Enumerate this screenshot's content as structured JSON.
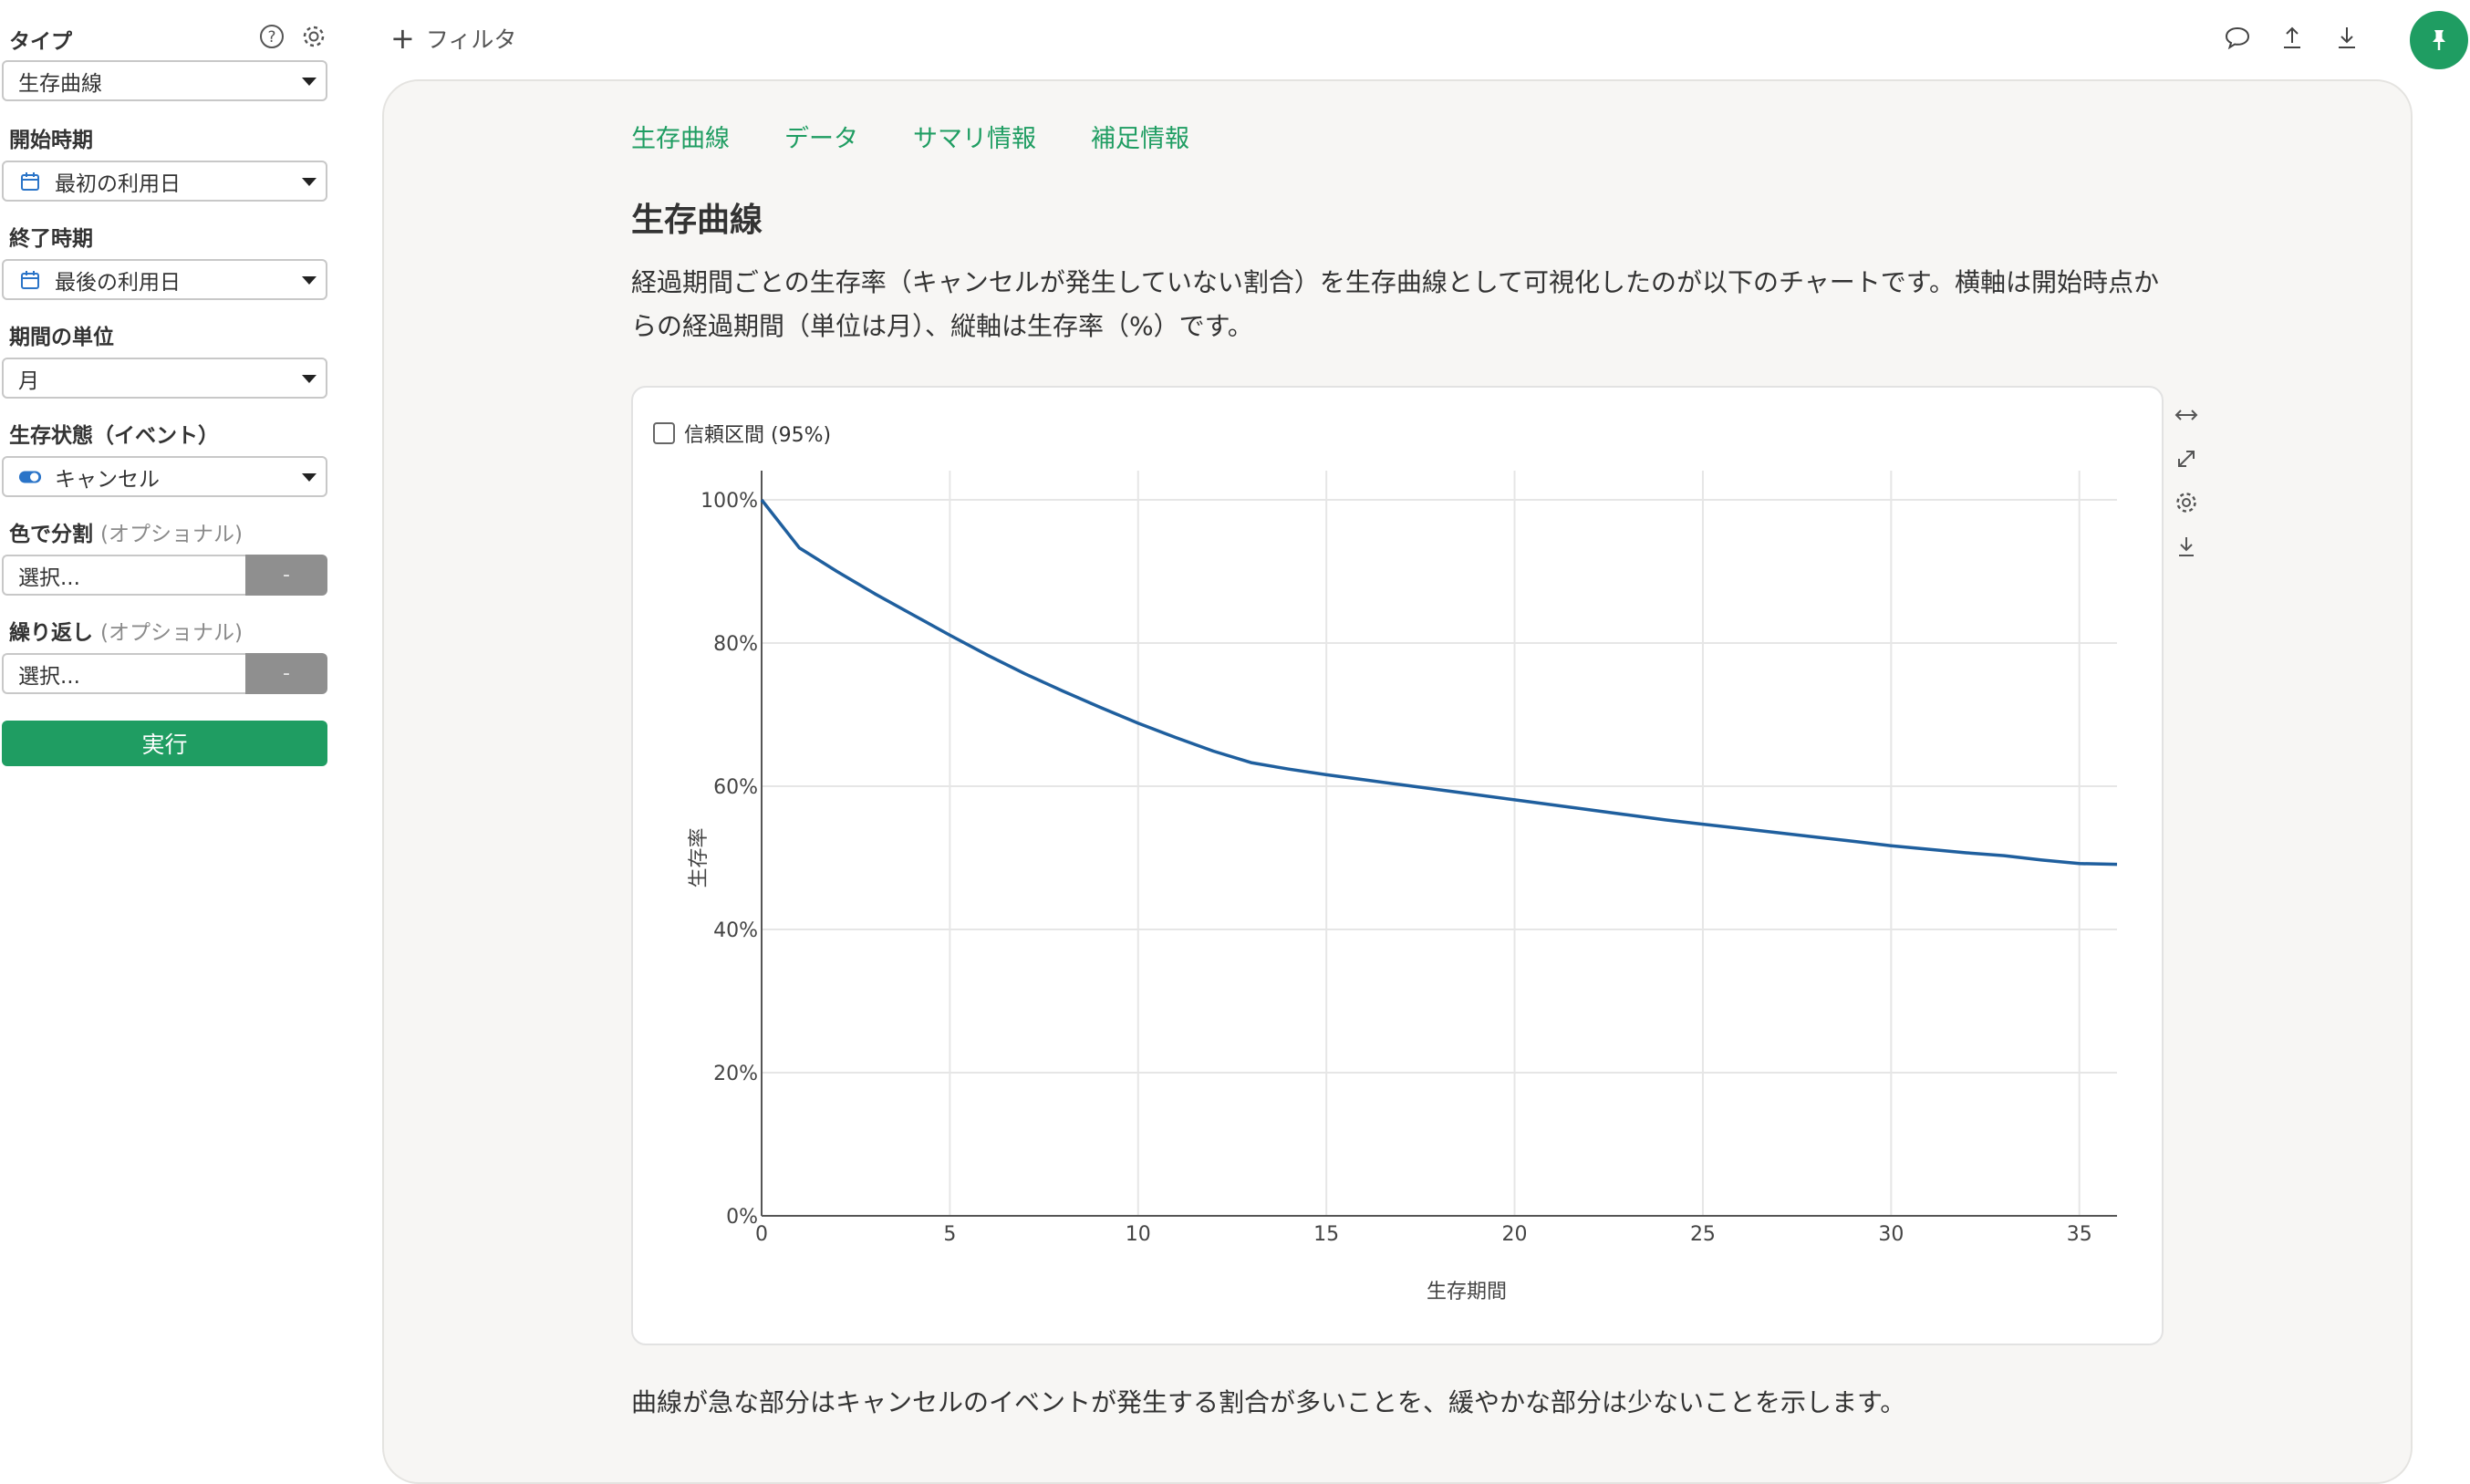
{
  "sidebar": {
    "type": {
      "label": "タイプ",
      "value": "生存曲線"
    },
    "start": {
      "label": "開始時期",
      "value": "最初の利用日"
    },
    "end": {
      "label": "終了時期",
      "value": "最後の利用日"
    },
    "unit": {
      "label": "期間の単位",
      "value": "月"
    },
    "event": {
      "label": "生存状態（イベント）",
      "value": "キャンセル"
    },
    "color_split": {
      "label": "色で分割",
      "optional": "(オプショナル)",
      "placeholder": "選択...",
      "button": "-"
    },
    "repeat": {
      "label": "繰り返し",
      "optional": "(オプショナル)",
      "placeholder": "選択...",
      "button": "-"
    },
    "run_button": "実行"
  },
  "topbar": {
    "filter_label": "フィルタ",
    "icons": [
      "comment-icon",
      "upload-icon",
      "download-icon",
      "pin-icon"
    ]
  },
  "tabs": [
    "生存曲線",
    "データ",
    "サマリ情報",
    "補足情報"
  ],
  "section_title": "生存曲線",
  "description": "経過期間ごとの生存率（キャンセルが発生していない割合）を生存曲線として可視化したのが以下のチャートです。横軸は開始時点からの経過期間（単位は月）、縦軸は生存率（%）です。",
  "chart": {
    "ci_label": "信頼区間 (95%)",
    "tool_icons": [
      "expand-horizontal-icon",
      "fullscreen-icon",
      "gear-icon",
      "download-icon"
    ]
  },
  "footer": "曲線が急な部分はキャンセルのイベントが発生する割合が多いことを、緩やかな部分は少ないことを示します。",
  "colors": {
    "accent": "#1f9d62",
    "line": "#1f5f9e",
    "grid": "#e6e6e6"
  },
  "chart_data": {
    "type": "line",
    "title": "",
    "xlabel": "生存期間",
    "ylabel": "生存率",
    "xlim": [
      0,
      36
    ],
    "ylim": [
      0,
      100
    ],
    "x_ticks": [
      0,
      5,
      10,
      15,
      20,
      25,
      30,
      35
    ],
    "y_ticks": [
      0,
      20,
      40,
      60,
      80,
      100
    ],
    "y_tick_labels": [
      "0%",
      "20%",
      "40%",
      "60%",
      "80%",
      "100%"
    ],
    "grid": true,
    "series": [
      {
        "x": [
          0,
          1,
          2,
          3,
          4,
          5,
          6,
          7,
          8,
          9,
          10,
          11,
          12,
          13,
          14,
          15,
          16,
          17,
          18,
          19,
          20,
          21,
          22,
          23,
          24,
          25,
          26,
          27,
          28,
          29,
          30,
          31,
          32,
          33,
          34,
          35,
          36
        ],
        "values": [
          100,
          93.3,
          90.0,
          86.9,
          84.0,
          81.1,
          78.3,
          75.7,
          73.3,
          71.0,
          68.8,
          66.8,
          64.9,
          63.3,
          62.4,
          61.6,
          60.9,
          60.2,
          59.5,
          58.8,
          58.1,
          57.4,
          56.7,
          56.0,
          55.3,
          54.7,
          54.1,
          53.5,
          52.9,
          52.3,
          51.7,
          51.2,
          50.7,
          50.3,
          49.7,
          49.2,
          49.1
        ]
      }
    ]
  }
}
